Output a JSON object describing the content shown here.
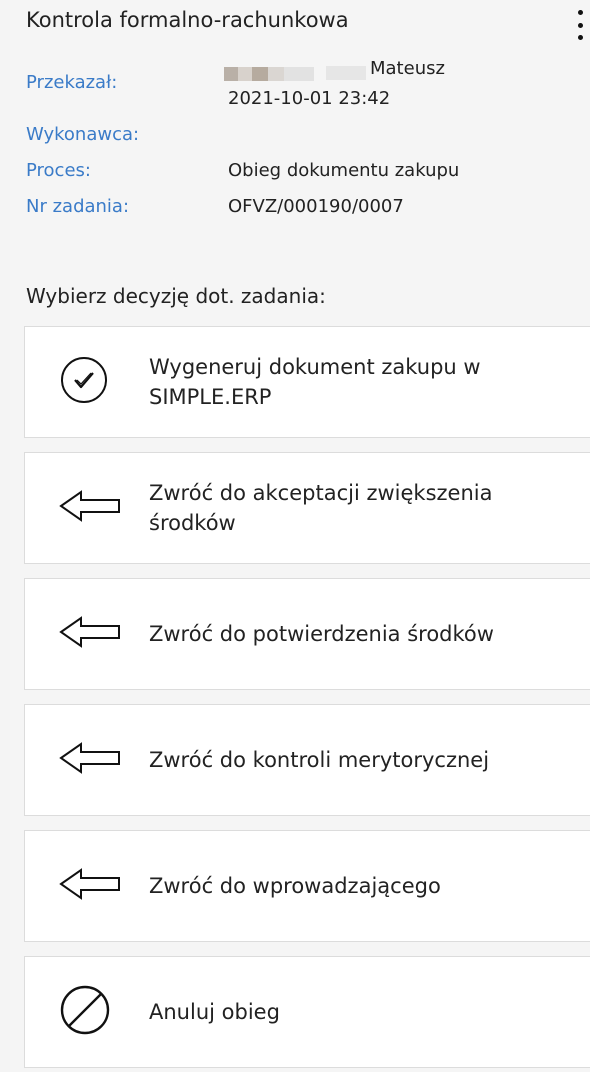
{
  "task": {
    "title": "Kontrola formalno-rachunkowa",
    "menu_icon": "more-vertical-icon"
  },
  "details": {
    "przekazal_label": "Przekazał:",
    "przekazal_name": "Mateusz",
    "przekazal_date": "2021-10-01 23:42",
    "wykonawca_label": "Wykonawca:",
    "proces_label": "Proces:",
    "proces_value": "Obieg dokumentu zakupu",
    "nr_label": "Nr zadania:",
    "nr_value": "OFVZ/000190/0007"
  },
  "decision": {
    "prompt": "Wybierz decyzję dot. zadania:",
    "options": [
      {
        "label": "Wygeneruj dokument zakupu w SIMPLE.ERP",
        "icon": "check-circle-icon"
      },
      {
        "label": "Zwróć do akceptacji zwiększenia środków",
        "icon": "arrow-left-icon"
      },
      {
        "label": "Zwróć do potwierdzenia środków",
        "icon": "arrow-left-icon"
      },
      {
        "label": "Zwróć do kontroli merytorycznej",
        "icon": "arrow-left-icon"
      },
      {
        "label": "Zwróć do wprowadzającego",
        "icon": "arrow-left-icon"
      },
      {
        "label": "Anuluj obieg",
        "icon": "cancel-icon"
      }
    ]
  },
  "colors": {
    "label_blue": "#3a7bc8",
    "background": "#f5f5f5",
    "card": "#ffffff"
  }
}
